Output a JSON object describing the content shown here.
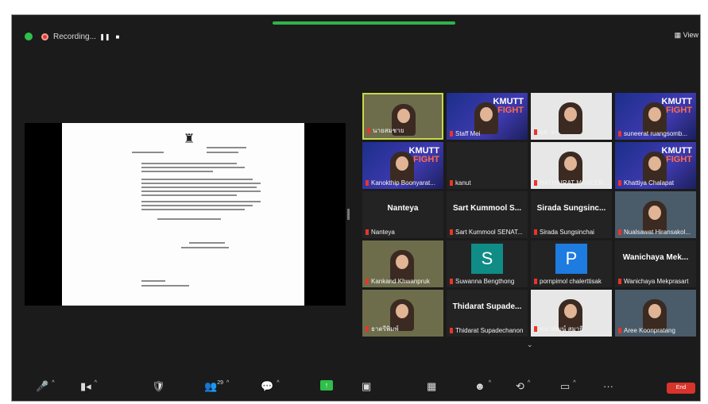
{
  "recording": {
    "label": "Recording..."
  },
  "view": {
    "label": "View"
  },
  "participants_count": "29",
  "end": {
    "label": "End"
  },
  "tiles": [
    {
      "name": "นายสมชาย",
      "type": "photo",
      "active": true
    },
    {
      "name": "Staff Mei",
      "type": "kmutt"
    },
    {
      "name": "ผศ. ดร.",
      "type": "photo"
    },
    {
      "name": "suneerat ruangsomb...",
      "type": "kmutt"
    },
    {
      "name": "Kanokthip Boonyarat...",
      "type": "kmutt"
    },
    {
      "name": "kanut",
      "type": "dark"
    },
    {
      "name": "HATHAIRAT MANEERAT",
      "type": "photo"
    },
    {
      "name": "Khattiya Chalapat",
      "type": "kmutt"
    },
    {
      "name": "Nanteya",
      "type": "text",
      "big": "Nanteya"
    },
    {
      "name": "Sart Kummool SENAT...",
      "type": "text",
      "big": "Sart Kummool S..."
    },
    {
      "name": "Sirada Sungsinchai",
      "type": "text",
      "big": "Sirada Sungsinc..."
    },
    {
      "name": "Nualsawat Hiransakol...",
      "type": "photo"
    },
    {
      "name": "Kankand Khwanpruk",
      "type": "photo"
    },
    {
      "name": "Suwanna Bengthong",
      "type": "avatar",
      "letter": "S",
      "color": "#0f8c86"
    },
    {
      "name": "pornpimol chalerttisak",
      "type": "avatar",
      "letter": "P",
      "color": "#1e7be0"
    },
    {
      "name": "Wanichaya Mekprasart",
      "type": "text",
      "big": "Wanichaya Mek..."
    },
    {
      "name": "ธาตรีพิมพ์",
      "type": "photo"
    },
    {
      "name": "Thidarat Supadechanon",
      "type": "text",
      "big": "Thidarat Supade..."
    },
    {
      "name": "ชนาพัฒน์ สมาธิ",
      "type": "photo"
    },
    {
      "name": "Aree Koonpratang",
      "type": "photo"
    }
  ]
}
